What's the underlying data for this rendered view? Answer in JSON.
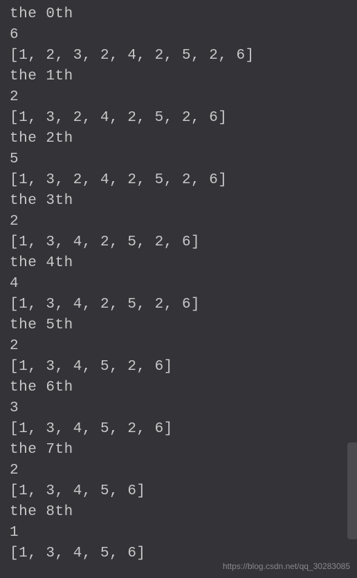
{
  "terminal": {
    "lines": [
      "the 0th",
      "6",
      "[1, 2, 3, 2, 4, 2, 5, 2, 6]",
      "the 1th",
      "2",
      "[1, 3, 2, 4, 2, 5, 2, 6]",
      "the 2th",
      "5",
      "[1, 3, 2, 4, 2, 5, 2, 6]",
      "the 3th",
      "2",
      "[1, 3, 4, 2, 5, 2, 6]",
      "the 4th",
      "4",
      "[1, 3, 4, 2, 5, 2, 6]",
      "the 5th",
      "2",
      "[1, 3, 4, 5, 2, 6]",
      "the 6th",
      "3",
      "[1, 3, 4, 5, 2, 6]",
      "the 7th",
      "2",
      "[1, 3, 4, 5, 6]",
      "the 8th",
      "1",
      "[1, 3, 4, 5, 6]"
    ]
  },
  "watermark": "https://blog.csdn.net/qq_30283085"
}
